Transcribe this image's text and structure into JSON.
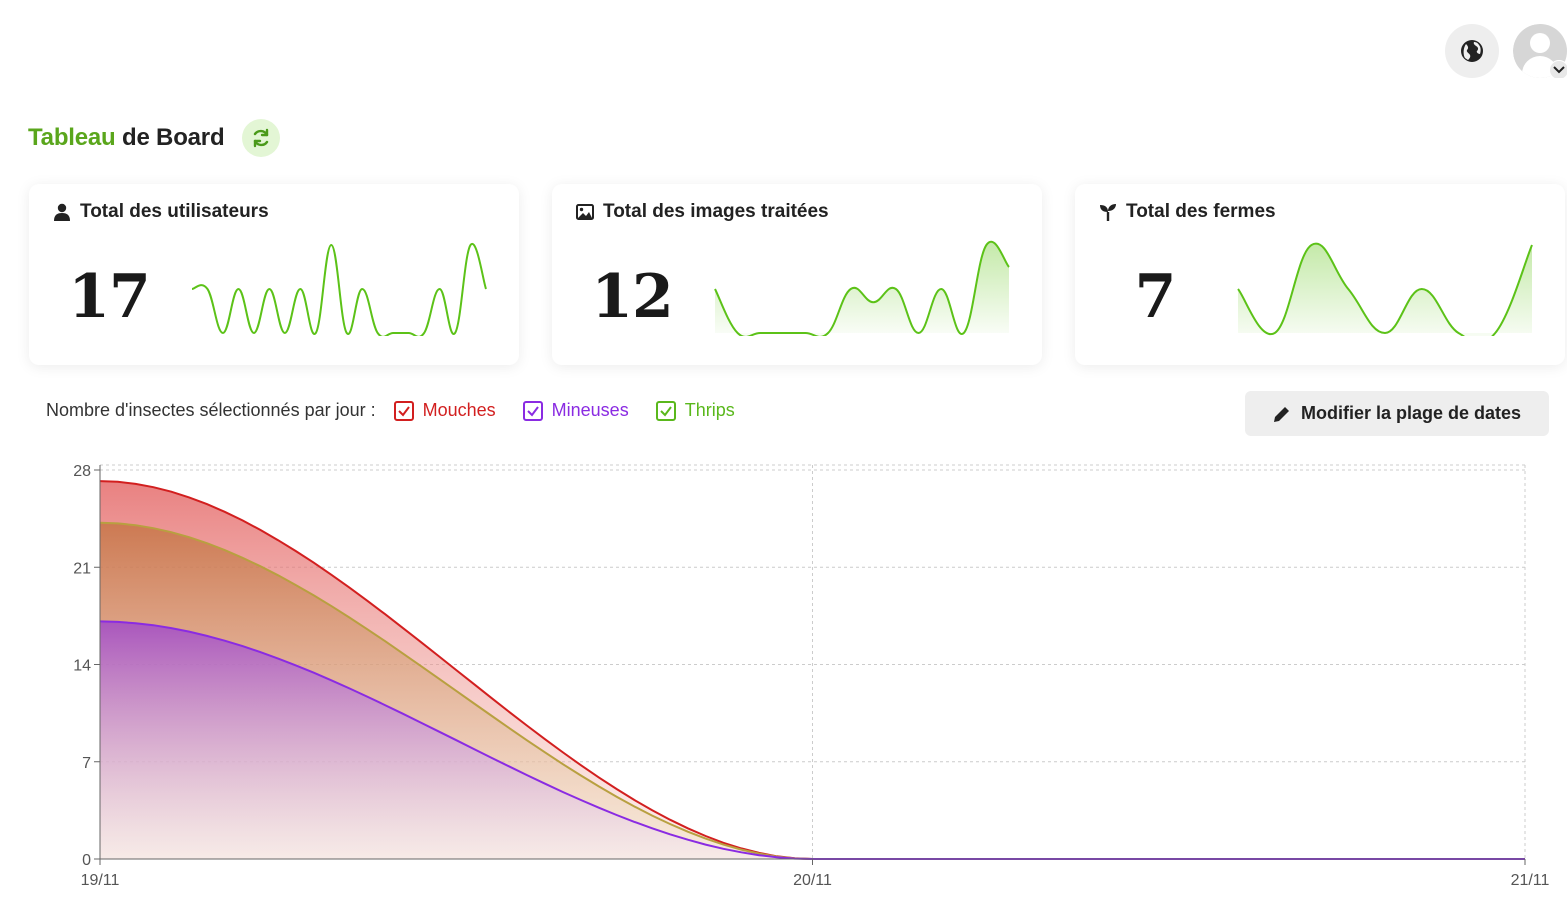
{
  "header": {
    "globe_icon": "globe-icon",
    "avatar_icon": "user-avatar",
    "caret_icon": "chevron-down-icon"
  },
  "page": {
    "title_accent": "Tableau",
    "title_rest": " de Board",
    "refresh_icon": "refresh-icon",
    "accent_color": "#5aa61c"
  },
  "stats": [
    {
      "icon": "user-icon",
      "title": "Total des utilisateurs",
      "value": "17",
      "spark": [
        0.5,
        0.5,
        0,
        0.5,
        0,
        0.5,
        0,
        0.5,
        0,
        1,
        0,
        0.5,
        0,
        0,
        0,
        0,
        0.5,
        0,
        1,
        0.5
      ],
      "fill": false
    },
    {
      "icon": "image-icon",
      "title": "Total des images traitées",
      "value": "12",
      "spark": [
        0.5,
        0,
        0,
        0,
        0,
        0,
        0.5,
        0.35,
        0.5,
        0.0,
        0.5,
        0,
        1,
        0.75
      ],
      "fill": true
    },
    {
      "icon": "seedling-icon",
      "title": "Total des fermes",
      "value": "7",
      "spark": [
        0.5,
        0,
        1,
        0.5,
        0,
        0.5,
        0,
        0,
        1
      ],
      "fill": true
    }
  ],
  "filters": {
    "label": "Nombre d'insectes sélectionnés par jour :",
    "items": [
      {
        "label": "Mouches",
        "color": "#d21f1f",
        "checked": true
      },
      {
        "label": "Mineuses",
        "color": "#8a2be2",
        "checked": true
      },
      {
        "label": "Thrips",
        "color": "#5ab81c",
        "checked": true
      }
    ]
  },
  "date_button": {
    "label": "Modifier la plage de dates",
    "icon": "pencil-icon"
  },
  "chart_data": {
    "type": "area",
    "x": [
      "19/11",
      "20/11",
      "21/11"
    ],
    "y_ticks": [
      0,
      7,
      14,
      21,
      28
    ],
    "ylim": [
      0,
      28
    ],
    "grid": true,
    "series": [
      {
        "name": "Mouches",
        "color": "#d21f1f",
        "values": [
          27.2,
          0,
          0
        ]
      },
      {
        "name": "Thrips",
        "color": "#b8a040",
        "values": [
          24.2,
          0,
          0
        ]
      },
      {
        "name": "Mineuses",
        "color": "#8a2be2",
        "values": [
          17.1,
          0,
          0
        ]
      }
    ]
  }
}
